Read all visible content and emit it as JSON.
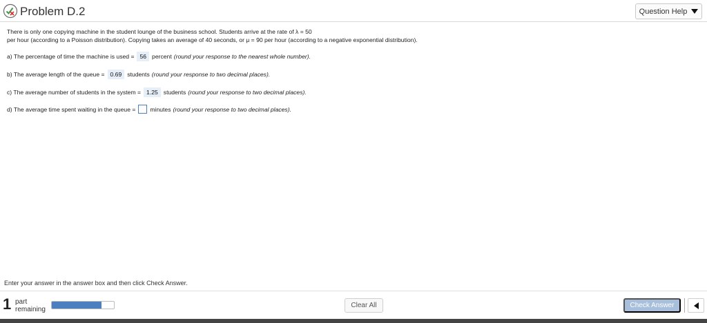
{
  "header": {
    "title": "Problem D.2",
    "help_label": "Question Help",
    "status_icon": "partial-correct-icon"
  },
  "problem": {
    "line1": "There is only one copying machine in the student lounge of the business school. Students arrive at the rate of λ = 50",
    "line2": "per hour (according to a Poisson distribution). Copying takes an average of 40 seconds, or μ = 90 per hour (according to a negative exponential distribution)."
  },
  "questions": [
    {
      "prefix": "a) The percentage of time the machine is used =",
      "answer": "56",
      "unit": "percent",
      "instruction": "(round your response to the nearest whole number)."
    },
    {
      "prefix": "b) The average length of the queue =",
      "answer": "0.69",
      "unit": "students",
      "instruction": "(round your response to two decimal places)."
    },
    {
      "prefix": "c) The average number of students in the system =",
      "answer": "1.25",
      "unit": "students",
      "instruction": "(round your response to two decimal places)."
    },
    {
      "prefix": "d) The average time spent waiting in the queue =",
      "answer": "",
      "unit": "minutes",
      "instruction": "(round your response to two decimal places)."
    }
  ],
  "footer": {
    "note": "Enter your answer in the answer box and then click Check Answer.",
    "parts_count": "1",
    "parts_label1": "part",
    "parts_label2": "remaining",
    "progress_percent": 80,
    "clear_label": "Clear All",
    "check_label": "Check Answer"
  },
  "colors": {
    "answer_bg": "#e6eef8",
    "progress": "#4b7fc0",
    "check_button": "#a8bfdc",
    "status_icon": "#3f9a4a"
  }
}
